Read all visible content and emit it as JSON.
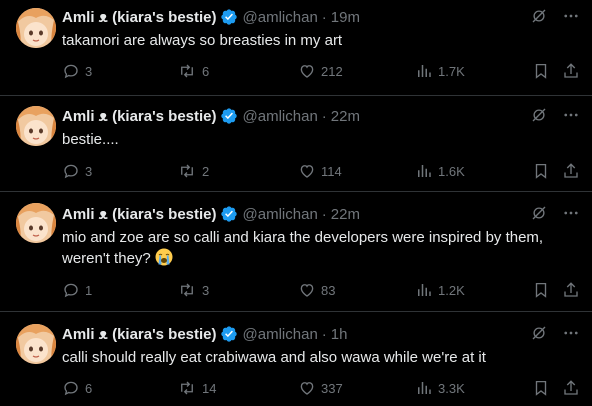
{
  "author": {
    "name": "Amli ᴥ (kiara's bestie)",
    "handle": "@amlichan",
    "verified": true
  },
  "colors": {
    "background": "#000000",
    "text": "#e7e9ea",
    "muted": "#71767b",
    "verified": "#1d9bf0",
    "divider": "#2f3336"
  },
  "tweets": [
    {
      "time": "19m",
      "text": "takamori are always so breasties in my art",
      "replies": "3",
      "reposts": "6",
      "likes": "212",
      "views": "1.7K"
    },
    {
      "time": "22m",
      "text": "bestie....",
      "replies": "3",
      "reposts": "2",
      "likes": "114",
      "views": "1.6K"
    },
    {
      "time": "22m",
      "text": "mio and zoe are so calli and kiara the developers were inspired by them, weren't they?",
      "emoji": "loudly-crying-face",
      "replies": "1",
      "reposts": "3",
      "likes": "83",
      "views": "1.2K"
    },
    {
      "time": "1h",
      "text": "calli should really eat crabiwawa and also wawa while we're at it",
      "replies": "6",
      "reposts": "14",
      "likes": "337",
      "views": "3.3K"
    }
  ]
}
